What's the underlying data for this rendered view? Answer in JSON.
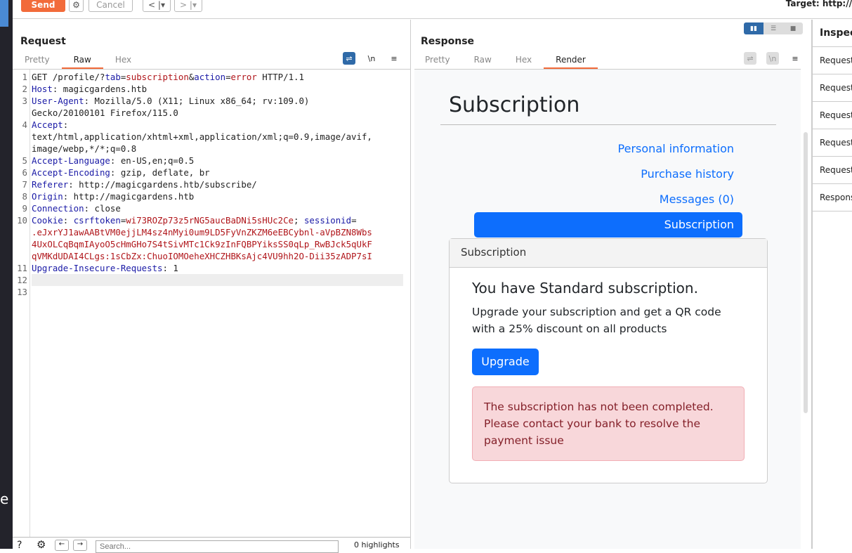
{
  "left_strip": {
    "text": "e"
  },
  "toolbar": {
    "send": "Send",
    "cancel": "Cancel",
    "back": "<",
    "forward": ">",
    "dropdown": "▾",
    "target": "Target: http://"
  },
  "request": {
    "title": "Request",
    "tabs": [
      "Pretty",
      "Raw",
      "Hex"
    ],
    "active_tab": "Raw",
    "icons": {
      "wrap": "⇌",
      "newline": "\\n",
      "menu": "≡"
    },
    "lines": [
      [
        [
          "",
          "GET /profile/?"
        ],
        [
          "k",
          "tab"
        ],
        [
          "",
          "="
        ],
        [
          "v",
          "subscription"
        ],
        [
          "",
          "&"
        ],
        [
          "k",
          "action"
        ],
        [
          "",
          "="
        ],
        [
          "v",
          "error"
        ],
        [
          "",
          " HTTP/1.1"
        ]
      ],
      [
        [
          "k",
          "Host"
        ],
        [
          "",
          ": magicgardens.htb"
        ]
      ],
      [
        [
          "k",
          "User-Agent"
        ],
        [
          "",
          ": Mozilla/5.0 (X11; Linux x86_64; rv:109.0)"
        ]
      ],
      [
        [
          "",
          "Gecko/20100101 Firefox/115.0"
        ]
      ],
      [
        [
          "k",
          "Accept"
        ],
        [
          "",
          ":"
        ]
      ],
      [
        [
          "",
          "text/html,application/xhtml+xml,application/xml;q=0.9,image/avif,"
        ]
      ],
      [
        [
          "",
          "image/webp,*/*;q=0.8"
        ]
      ],
      [
        [
          "k",
          "Accept-Language"
        ],
        [
          "",
          ": en-US,en;q=0.5"
        ]
      ],
      [
        [
          "k",
          "Accept-Encoding"
        ],
        [
          "",
          ": gzip, deflate, br"
        ]
      ],
      [
        [
          "k",
          "Referer"
        ],
        [
          "",
          ": http://magicgardens.htb/subscribe/"
        ]
      ],
      [
        [
          "k",
          "Origin"
        ],
        [
          "",
          ": http://magicgardens.htb"
        ]
      ],
      [
        [
          "k",
          "Connection"
        ],
        [
          "",
          ": close"
        ]
      ],
      [
        [
          "k",
          "Cookie"
        ],
        [
          "",
          ": "
        ],
        [
          "k",
          "csrftoken"
        ],
        [
          "",
          "="
        ],
        [
          "v",
          "wi73ROZp73z5rNG5aucBaDNi5sHUc2Ce"
        ],
        [
          "",
          "; "
        ],
        [
          "k",
          "sessionid"
        ],
        [
          "",
          "="
        ]
      ],
      [
        [
          "v",
          ".eJxrYJ1awAABtVM0ejjLM4sz4nMyi0um9LD5FyVnZKZM6eEBCybnl-aVpBZN8Wbs"
        ]
      ],
      [
        [
          "v",
          "4UxOLCqBqmIAyoO5cHmGHo7S4tSivMTc1Ck9zInFQBPYiksSS0qLp_RwBJck5qUkF"
        ]
      ],
      [
        [
          "v",
          "qVMKdUDAI4CLgs:1sCbZx:ChuoIOMOeheXHCZHBKsAjc4VU9hh2O-Dii35zADP7sI"
        ]
      ],
      [
        [
          "k",
          "Upgrade-Insecure-Requests"
        ],
        [
          "",
          ": 1"
        ]
      ],
      [
        [
          "",
          ""
        ]
      ],
      [
        [
          "",
          ""
        ]
      ]
    ],
    "line_numbers": [
      "1",
      "2",
      "3",
      "",
      "4",
      "",
      "",
      "5",
      "6",
      "7",
      "8",
      "9",
      "10",
      "",
      "",
      "",
      "11",
      "12",
      "13"
    ],
    "search": {
      "placeholder": "Search...",
      "highlights": "0 highlights"
    }
  },
  "response": {
    "title": "Response",
    "tabs": [
      "Pretty",
      "Raw",
      "Hex",
      "Render"
    ],
    "active_tab": "Render",
    "page": {
      "heading": "Subscription",
      "nav": [
        "Personal information",
        "Purchase history",
        "Messages (0)",
        "Subscription"
      ],
      "card_header": "Subscription",
      "card_title": "You have Standard subscription.",
      "card_text": "Upgrade your subscription and get a QR code with a 25% discount on all products",
      "upgrade": "Upgrade",
      "alert": "The subscription has not been completed. Please contact your bank to resolve the payment issue"
    }
  },
  "inspector": {
    "title": "Inspector",
    "rows": [
      "Request attributes",
      "Request query parameters",
      "Request body parameters",
      "Request cookies",
      "Request headers",
      "Response headers"
    ]
  },
  "colors": {
    "accent": "#f26b3a",
    "link": "#0d6efd",
    "alert_bg": "#f8d7da",
    "alert_text": "#842029"
  }
}
